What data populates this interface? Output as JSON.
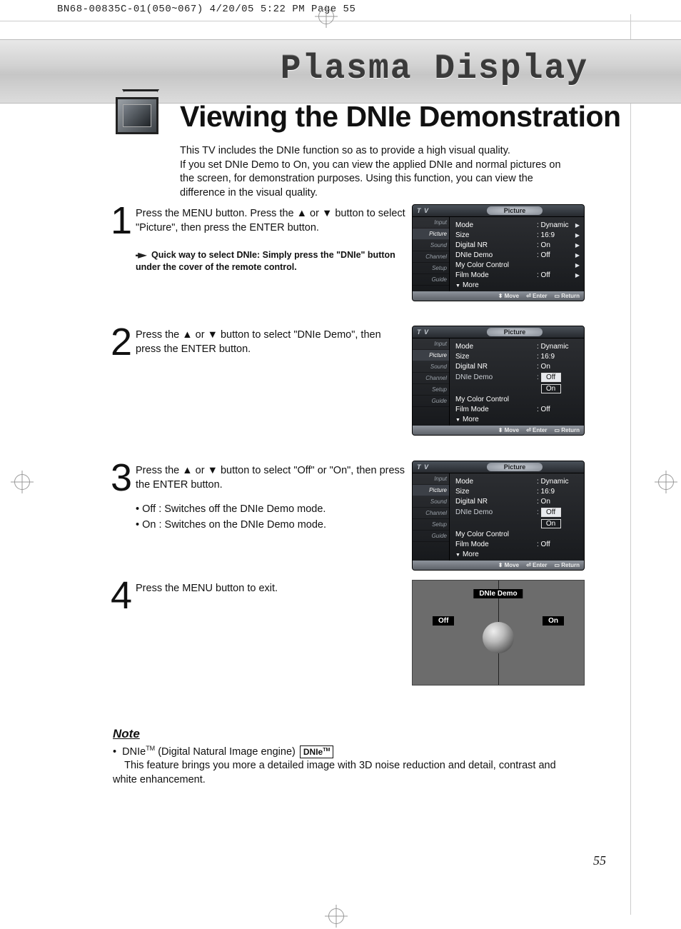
{
  "print_mark": "BN68-00835C-01(050~067)  4/20/05  5:22 PM  Page 55",
  "header_title": "Plasma Display",
  "page_title": "Viewing the DNIe Demonstration",
  "intro": "This TV includes the DNIe function so as to provide a high visual quality.\nIf you set DNIe Demo to On, you can view the applied DNIe and normal pictures on the screen, for demonstration purposes. Using this function, you can view the difference in the visual quality.",
  "steps": [
    {
      "num": "1",
      "text": "Press the MENU button. Press the ▲ or ▼ button to select \"Picture\", then press the ENTER button.",
      "tip": "Quick way to select DNIe: Simply press the \"DNIe\" button under the cover of the remote control."
    },
    {
      "num": "2",
      "text": "Press the ▲ or ▼ button to select \"DNIe Demo\", then press the ENTER button."
    },
    {
      "num": "3",
      "text": "Press the ▲ or ▼ button to select \"Off\" or \"On\", then press the ENTER button.",
      "bullets": [
        "Off : Switches off the DNIe Demo mode.",
        "On : Switches on the DNIe Demo mode."
      ]
    },
    {
      "num": "4",
      "text": "Press the MENU button to exit."
    }
  ],
  "osd_common": {
    "tv": "T V",
    "section": "Picture",
    "tabs": [
      "Input",
      "Picture",
      "Sound",
      "Channel",
      "Setup",
      "Guide"
    ],
    "foot": {
      "move": "Move",
      "enter": "Enter",
      "return": "Return"
    },
    "more": "More"
  },
  "osd1_rows": [
    {
      "k": "Mode",
      "v": ": Dynamic",
      "c": "▶"
    },
    {
      "k": "Size",
      "v": ": 16:9",
      "c": "▶"
    },
    {
      "k": "Digital NR",
      "v": ": On",
      "c": "▶"
    },
    {
      "k": "DNIe Demo",
      "v": ": Off",
      "c": "▶"
    },
    {
      "k": "My Color Control",
      "v": "",
      "c": "▶"
    },
    {
      "k": "Film Mode",
      "v": ": Off",
      "c": "▶"
    }
  ],
  "osd2_rows": [
    {
      "k": "Mode",
      "v": ": Dynamic"
    },
    {
      "k": "Size",
      "v": ": 16:9"
    },
    {
      "k": "Digital NR",
      "v": ": On"
    },
    {
      "k": "DNIe Demo",
      "opts": [
        "Off",
        "On"
      ],
      "sel": 0,
      "prefix": ":"
    },
    {
      "k": "My Color Control"
    },
    {
      "k": "Film Mode",
      "v": ": Off"
    }
  ],
  "osd3_rows": [
    {
      "k": "Mode",
      "v": ": Dynamic"
    },
    {
      "k": "Size",
      "v": ": 16:9"
    },
    {
      "k": "Digital NR",
      "v": ": On"
    },
    {
      "k": "DNIe Demo",
      "opts": [
        "Off",
        "On"
      ],
      "sel": 0,
      "prefix": ":"
    },
    {
      "k": "My Color Control"
    },
    {
      "k": "Film Mode",
      "v": ": Off"
    }
  ],
  "demo": {
    "title": "DNIe Demo",
    "left": "Off",
    "right": "On"
  },
  "note": {
    "heading": "Note",
    "lead": "DNIe",
    "tm": "TM",
    "paren": " (Digital Natural Image engine) ",
    "logo": "DNIe",
    "body": "This feature brings you more a detailed image with 3D noise reduction and detail, contrast and white enhancement."
  },
  "page_number": "55"
}
